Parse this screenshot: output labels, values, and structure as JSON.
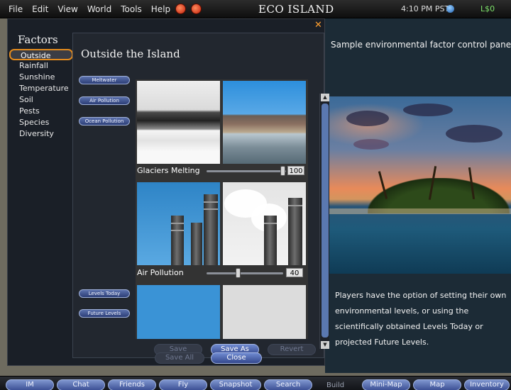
{
  "menubar": {
    "items": [
      "File",
      "Edit",
      "View",
      "World",
      "Tools",
      "Help"
    ],
    "title": "ECO ISLAND",
    "clock": "4:10 PM PST",
    "balance": "L$0"
  },
  "world": {
    "caption_top": "Sample environmental factor control panel",
    "caption_bottom": "Players have the option of setting their own environmental levels, or using the scientifically obtained Levels Today or projected Future Levels."
  },
  "panel": {
    "close_symbol": "✕",
    "factors_title": "Factors",
    "factors": [
      "Outside",
      "Rainfall",
      "Sunshine",
      "Temperature",
      "Soil",
      "Pests",
      "Species",
      "Diversity"
    ],
    "selected_factor": "Outside",
    "subtitle": "Outside the Island",
    "side_buttons": {
      "meltwater": "Meltwater",
      "air_pollution": "Air Pollution",
      "ocean_pollution": "Ocean Pollution",
      "levels_today": "Levels Today",
      "future_levels": "Future Levels"
    },
    "sliders": {
      "glaciers": {
        "label": "Glaciers Melting",
        "value": "100",
        "level": 100
      },
      "air": {
        "label": "Air Pollution",
        "value": "40",
        "level": 40
      }
    },
    "buttons": {
      "save": "Save",
      "save_as": "Save As",
      "revert": "Revert",
      "save_all": "Save All",
      "close": "Close"
    }
  },
  "toolbar": {
    "buttons": [
      "IM",
      "Chat",
      "Friends",
      "Fly",
      "Snapshot",
      "Search",
      "Build",
      "Mini-Map",
      "Map",
      "Inventory"
    ]
  },
  "colors": {
    "accent_orange": "#e38b1e",
    "button_blue": "#4a60a8",
    "balance_green": "#7ee26a"
  }
}
